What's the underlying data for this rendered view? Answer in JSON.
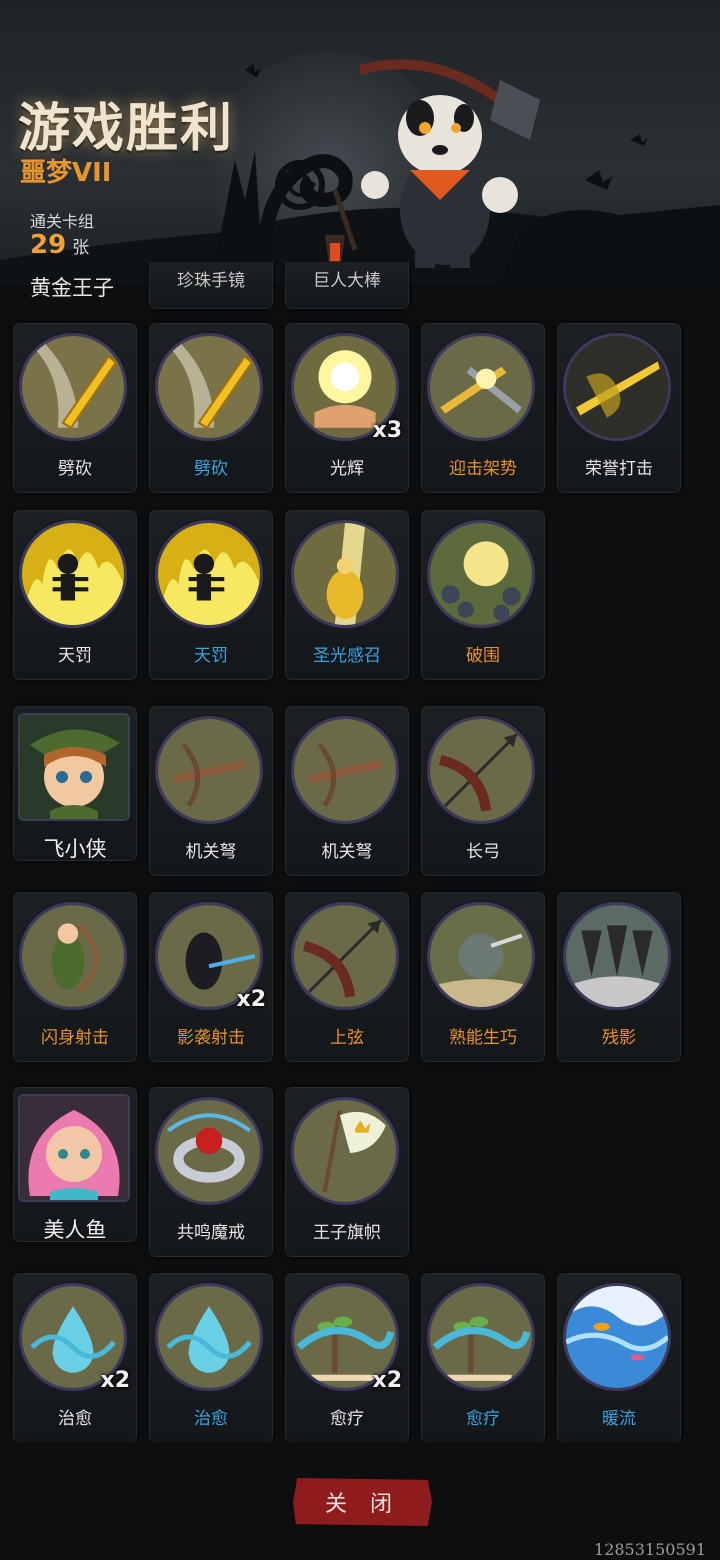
{
  "header": {
    "title": "游戏胜利",
    "difficulty": "噩梦VII",
    "deck_label": "通关卡组",
    "deck_count": "29",
    "deck_unit": "张"
  },
  "heroes": [
    {
      "name": "黄金王子",
      "cards_partial": [
        "珍珠手镜",
        "巨人大棒"
      ],
      "cards": [
        {
          "name": "劈砍",
          "color": "white",
          "icon": "golden-sword-slash-icon"
        },
        {
          "name": "劈砍",
          "color": "blue",
          "icon": "golden-sword-slash-icon"
        },
        {
          "name": "光辉",
          "color": "white",
          "icon": "radiant-hand-icon",
          "multiplier": "x3"
        },
        {
          "name": "迎击架势",
          "color": "orange",
          "icon": "clashing-swords-icon"
        },
        {
          "name": "荣誉打击",
          "color": "white",
          "icon": "honor-strike-icon"
        },
        {
          "name": "天罚",
          "color": "white",
          "icon": "burning-skeleton-icon"
        },
        {
          "name": "天罚",
          "color": "blue",
          "icon": "burning-skeleton-icon"
        },
        {
          "name": "圣光感召",
          "color": "blue",
          "icon": "holy-light-icon"
        },
        {
          "name": "破围",
          "color": "orange",
          "icon": "break-siege-icon"
        }
      ]
    },
    {
      "name": "飞小侠",
      "cards": [
        {
          "name": "机关弩",
          "color": "white",
          "icon": "crossbow-icon"
        },
        {
          "name": "机关弩",
          "color": "white",
          "icon": "crossbow-icon"
        },
        {
          "name": "长弓",
          "color": "white",
          "icon": "longbow-arrow-icon"
        },
        {
          "name": "闪身射击",
          "color": "orange",
          "icon": "dodge-shot-icon"
        },
        {
          "name": "影袭射击",
          "color": "orange",
          "icon": "shadow-shot-icon",
          "multiplier": "x2"
        },
        {
          "name": "上弦",
          "color": "orange",
          "icon": "longbow-arrow-icon"
        },
        {
          "name": "熟能生巧",
          "color": "orange",
          "icon": "practice-target-icon"
        },
        {
          "name": "残影",
          "color": "orange",
          "icon": "afterimage-icon"
        }
      ]
    },
    {
      "name": "美人鱼",
      "cards": [
        {
          "name": "共鸣魔戒",
          "color": "white",
          "icon": "magic-ring-icon"
        },
        {
          "name": "王子旗帜",
          "color": "white",
          "icon": "prince-banner-icon"
        },
        {
          "name": "治愈",
          "color": "white",
          "icon": "water-drop-icon",
          "multiplier": "x2"
        },
        {
          "name": "治愈",
          "color": "blue",
          "icon": "water-drop-icon"
        },
        {
          "name": "愈疗",
          "color": "white",
          "icon": "water-sprout-icon",
          "multiplier": "x2"
        },
        {
          "name": "愈疗",
          "color": "blue",
          "icon": "water-sprout-icon"
        },
        {
          "name": "暖流",
          "color": "blue",
          "icon": "warm-current-icon"
        }
      ]
    }
  ],
  "close_button": "关 闭",
  "footer_id": "12853150591",
  "colors": {
    "white": "#e6e6e6",
    "blue": "#3aa3e0",
    "orange": "#e8912d",
    "accent": "#8e1c1c"
  }
}
